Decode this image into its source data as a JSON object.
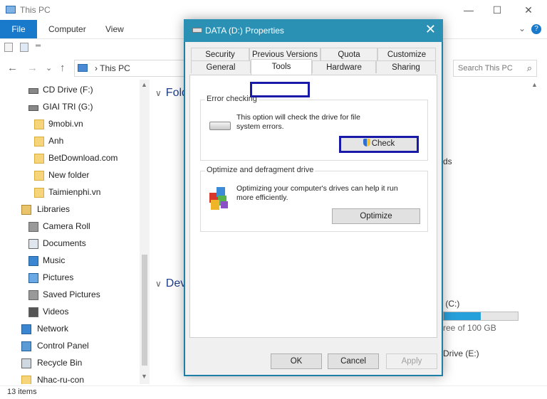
{
  "window": {
    "title": "This PC",
    "controls": {
      "minimize": "—",
      "maximize": "☐",
      "close": "✕"
    }
  },
  "ribbon": {
    "file": "File",
    "tabs": [
      "Computer",
      "View"
    ],
    "expand": "⌄",
    "help": "?"
  },
  "address": {
    "back": "←",
    "forward": "→",
    "recent": "⌄",
    "up": "↑",
    "crumb": "This PC",
    "search_placeholder": "Search This PC",
    "search_icon": "⌕"
  },
  "nav_pane": {
    "items": [
      {
        "label": "CD Drive (F:)",
        "icon": "drive-icon"
      },
      {
        "label": "GIAI TRI (G:)",
        "icon": "drive-icon"
      },
      {
        "label": "9mobi.vn",
        "icon": "folder-icon"
      },
      {
        "label": "Anh",
        "icon": "folder-icon"
      },
      {
        "label": "BetDownload.com",
        "icon": "folder-icon"
      },
      {
        "label": "New folder",
        "icon": "folder-icon"
      },
      {
        "label": "Taimienphi.vn",
        "icon": "folder-icon"
      },
      {
        "label": "Libraries",
        "icon": "libraries-icon"
      },
      {
        "label": "Camera Roll",
        "icon": "library-icon"
      },
      {
        "label": "Documents",
        "icon": "documents-icon"
      },
      {
        "label": "Music",
        "icon": "music-icon"
      },
      {
        "label": "Pictures",
        "icon": "pictures-icon"
      },
      {
        "label": "Saved Pictures",
        "icon": "pictures-icon"
      },
      {
        "label": "Videos",
        "icon": "videos-icon"
      },
      {
        "label": "Network",
        "icon": "network-icon"
      },
      {
        "label": "Control Panel",
        "icon": "control-panel-icon"
      },
      {
        "label": "Recycle Bin",
        "icon": "recycle-bin-icon"
      },
      {
        "label": "Nhac-ru-con",
        "icon": "folder-icon"
      }
    ]
  },
  "content": {
    "group_folders": "Fold",
    "group_devices": "Dev",
    "partial_ds": "ds",
    "drive_c_label": "c (C:)",
    "drive_c_free": "ree of 100 GB",
    "drive_c_used_fraction": 0.5,
    "drive_e_label": "Drive (E:)"
  },
  "status": {
    "items": "13 items"
  },
  "dialog": {
    "title": "DATA (D:) Properties",
    "close": "✕",
    "tabs_row1": [
      "Security",
      "Previous Versions",
      "Quota",
      "Customize"
    ],
    "tabs_row2": [
      "General",
      "Tools",
      "Hardware",
      "Sharing"
    ],
    "active_tab": "Tools",
    "error_checking": {
      "title": "Error checking",
      "text": "This option will check the drive for file system errors.",
      "button": "Check"
    },
    "optimize": {
      "title": "Optimize and defragment drive",
      "text": "Optimizing your computer's drives can help it run more efficiently.",
      "button": "Optimize"
    },
    "buttons": {
      "ok": "OK",
      "cancel": "Cancel",
      "apply": "Apply"
    }
  }
}
